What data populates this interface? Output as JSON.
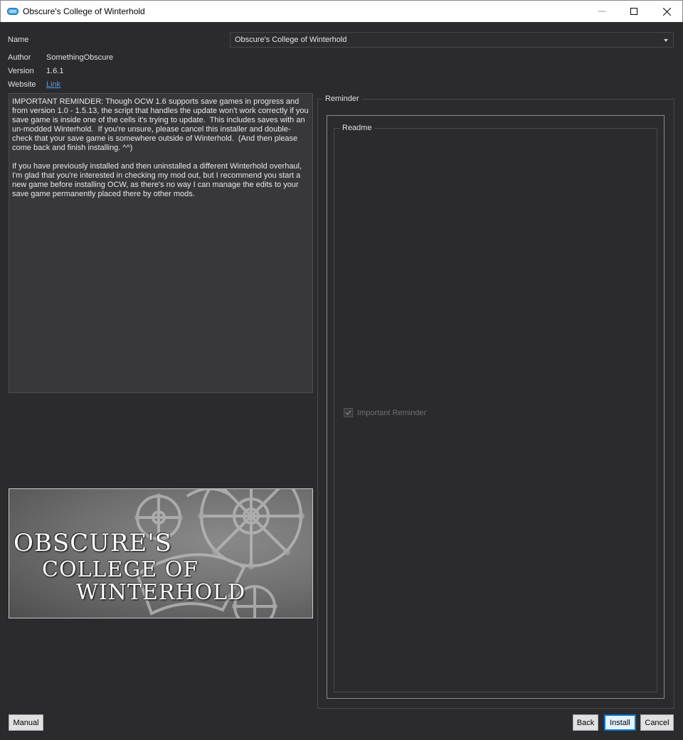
{
  "window": {
    "title": "Obscure's College of Winterhold",
    "icon": "app-icon",
    "controls": [
      "minimize-icon",
      "maximize-icon",
      "close-icon"
    ]
  },
  "info": {
    "name_label": "Name",
    "name_value": "Obscure's College of Winterhold",
    "author_label": "Author",
    "author_value": "SomethingObscure",
    "version_label": "Version",
    "version_value": "1.6.1",
    "website_label": "Website",
    "website_link": "Link"
  },
  "description": "IMPORTANT REMINDER: Though OCW 1.6 supports save games in progress and from version 1.0 - 1.5.13, the script that handles the update won't work correctly if you save game is inside one of the cells it's trying to update.  This includes saves with an un-modded Winterhold.  If you're unsure, please cancel this installer and double-check that your save game is somewhere outside of Winterhold.  (And then please come back and finish installing. ^^)\n\nIf you have previously installed and then uninstalled a different Winterhold overhaul, I'm glad that you're interested in checking my mod out, but I recommend you start a new game before installing OCW, as there's no way I can manage the edits to your save game permanently placed there by other mods.",
  "banner": {
    "line1": "OBSCURE'S",
    "line2": "COLLEGE OF",
    "line3": "WINTERHOLD"
  },
  "steps": {
    "step_title": "Reminder",
    "group_title": "Readme",
    "option_label": "Important Reminder",
    "option_checked": true
  },
  "buttons": {
    "manual": "Manual",
    "back": "Back",
    "install": "Install",
    "cancel": "Cancel"
  },
  "colors": {
    "background": "#2b2b2e",
    "link": "#3ea2ff",
    "accent": "#0078d7"
  }
}
